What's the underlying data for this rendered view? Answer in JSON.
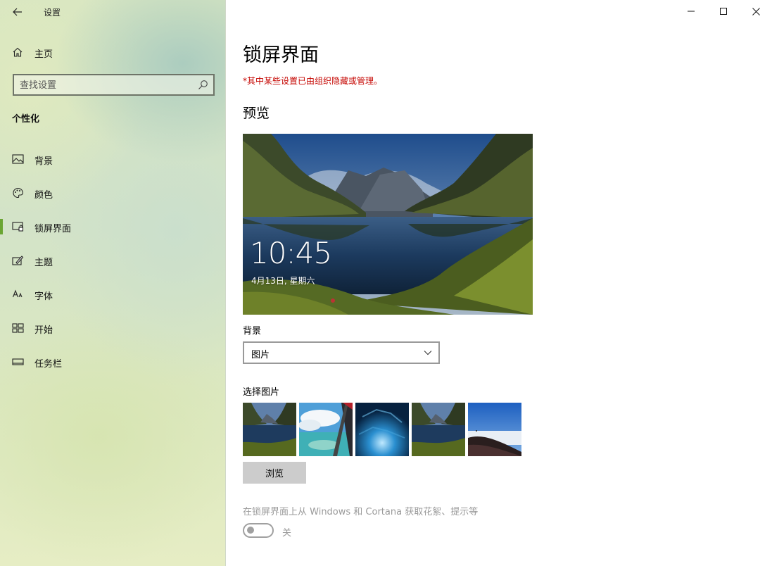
{
  "window": {
    "title": "设置",
    "controls": {
      "minimize": "minimize",
      "maximize": "maximize",
      "close": "close"
    }
  },
  "sidebar": {
    "home_label": "主页",
    "search": {
      "placeholder": "查找设置",
      "value": ""
    },
    "section_title": "个性化",
    "items": [
      {
        "label": "背景",
        "icon": "picture-icon",
        "active": false
      },
      {
        "label": "颜色",
        "icon": "palette-icon",
        "active": false
      },
      {
        "label": "锁屏界面",
        "icon": "lock-screen-icon",
        "active": true
      },
      {
        "label": "主题",
        "icon": "theme-brush-icon",
        "active": false
      },
      {
        "label": "字体",
        "icon": "font-icon",
        "active": false
      },
      {
        "label": "开始",
        "icon": "start-tiles-icon",
        "active": false
      },
      {
        "label": "任务栏",
        "icon": "taskbar-icon",
        "active": false
      }
    ],
    "active_color": "#6aa532"
  },
  "main": {
    "page_title": "锁屏界面",
    "policy_note": "*其中某些设置已由组织隐藏或管理。",
    "preview_heading": "预览",
    "preview": {
      "time": "10:45",
      "date": "4月13日, 星期六"
    },
    "background": {
      "label": "背景",
      "selected": "图片"
    },
    "choose_picture": {
      "label": "选择图片",
      "thumbnails": [
        "lake-mountains",
        "airplane-window-sea",
        "ice-cave",
        "lake-mountains",
        "volcano-summit"
      ]
    },
    "browse_label": "浏览",
    "spotlight": {
      "label": "在锁屏界面上从 Windows 和 Cortana 获取花絮、提示等",
      "state_label": "关",
      "enabled": false
    },
    "colors": {
      "policy_text": "#c50500",
      "disabled_text": "#9a9a9a"
    }
  }
}
